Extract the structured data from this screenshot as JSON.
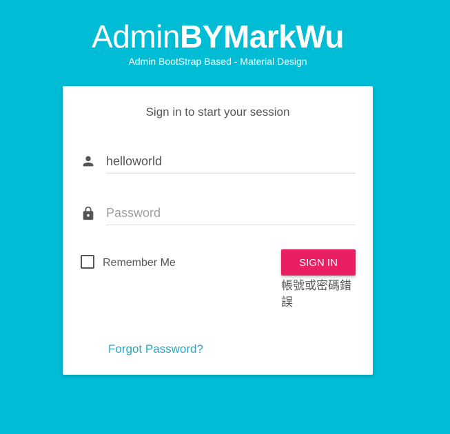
{
  "logo": {
    "light": "Admin",
    "bold": "BYMarkWu"
  },
  "subtitle": "Admin BootStrap Based - Material Design",
  "card": {
    "title": "Sign in to start your session",
    "username": {
      "value": "helloworld",
      "icon": "person-icon"
    },
    "password": {
      "placeholder": "Password",
      "icon": "lock-icon"
    },
    "remember_label": "Remember Me",
    "signin_label": "SIGN IN",
    "error_message": "帳號或密碼錯誤",
    "forgot_label": "Forgot Password?"
  },
  "colors": {
    "background": "#00bcd4",
    "button": "#e91e63",
    "link": "#26a9c4",
    "text": "#555555"
  }
}
